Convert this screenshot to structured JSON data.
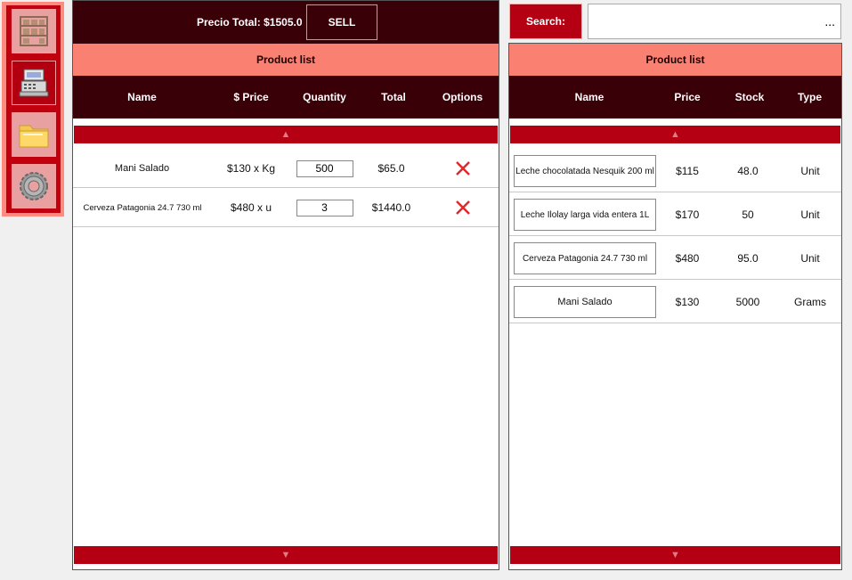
{
  "sidebar": {
    "items": [
      {
        "icon": "shelves-icon"
      },
      {
        "icon": "cash-register-icon"
      },
      {
        "icon": "folder-icon"
      },
      {
        "icon": "gear-icon"
      }
    ]
  },
  "cart": {
    "total_label": "Precio Total: $1505.0",
    "sell_label": "SELL",
    "title": "Product list",
    "columns": [
      "Name",
      "$ Price",
      "Quantity",
      "Total",
      "Options"
    ],
    "rows": [
      {
        "name": "Mani Salado",
        "price": "$130 x Kg",
        "quantity": "500",
        "total": "$65.0"
      },
      {
        "name": "Cerveza Patagonia 24.7 730 ml",
        "price": "$480 x u",
        "quantity": "3",
        "total": "$1440.0"
      }
    ]
  },
  "search": {
    "label": "Search:",
    "value": "...",
    "placeholder": ""
  },
  "catalog": {
    "title": "Product list",
    "columns": [
      "Name",
      "Price",
      "Stock",
      "Type"
    ],
    "rows": [
      {
        "name": "Leche chocolatada Nesquik 200 ml",
        "price": "$115",
        "stock": "48.0",
        "type": "Unit"
      },
      {
        "name": "Leche Ilolay larga vida entera 1L",
        "price": "$170",
        "stock": "50",
        "type": "Unit"
      },
      {
        "name": "Cerveza Patagonia 24.7 730 ml",
        "price": "$480",
        "stock": "95.0",
        "type": "Unit"
      },
      {
        "name": "Mani Salado",
        "price": "$130",
        "stock": "5000",
        "type": "Grams"
      }
    ]
  },
  "scroll": {
    "up": "▲",
    "down": "▼"
  },
  "colors": {
    "dark_maroon": "#3a0008",
    "accent_red": "#b50013",
    "salmon": "#fa8072",
    "delete_red": "#e0282e"
  }
}
